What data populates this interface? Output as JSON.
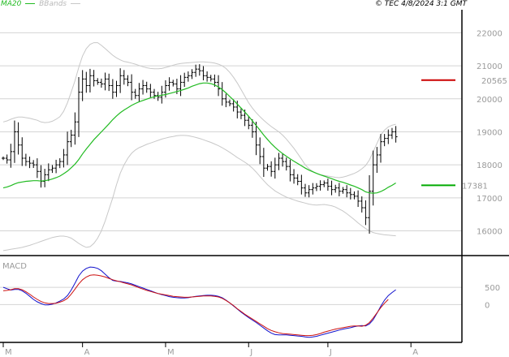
{
  "header": {
    "legend_ma": "MA20",
    "legend_bb": "BBands",
    "timestamp": "© TEC 4/8/2024 3:1 GMT"
  },
  "colors": {
    "ma": "#22bb22",
    "bbands": "#c8c8c8",
    "price": "#000000",
    "macd": "#1111cc",
    "signal": "#cc1111",
    "grid": "#d4d4d4",
    "resistance": "#cc0000",
    "support": "#00aa00"
  },
  "chart_data": [
    {
      "type": "line",
      "panel": "price",
      "title": "",
      "y_ticks": [
        16000,
        17000,
        18000,
        19000,
        20000,
        21000,
        22000
      ],
      "ylim": [
        15300,
        22600
      ],
      "x_labels": [
        "M",
        "A",
        "M",
        "J",
        "J",
        "A"
      ],
      "x_label_index": [
        0,
        21,
        43,
        65,
        86,
        108
      ],
      "series": [
        {
          "name": "price",
          "type": "ohlc",
          "values": [
            18200,
            18150,
            18400,
            19000,
            18600,
            18200,
            18100,
            18050,
            18000,
            17800,
            17500,
            17700,
            17850,
            17900,
            18000,
            18100,
            18300,
            18700,
            18900,
            19300,
            20200,
            20600,
            20400,
            20700,
            20550,
            20500,
            20450,
            20600,
            20400,
            20200,
            20400,
            20700,
            20600,
            20500,
            20200,
            20100,
            20300,
            20400,
            20300,
            20200,
            20100,
            20050,
            20200,
            20400,
            20500,
            20450,
            20300,
            20500,
            20650,
            20700,
            20800,
            20900,
            20850,
            20700,
            20650,
            20600,
            20500,
            20300,
            20000,
            19900,
            19850,
            19750,
            19600,
            19500,
            19350,
            19200,
            19000,
            18600,
            18250,
            17900,
            17950,
            17800,
            18000,
            18200,
            18100,
            17950,
            17700,
            17600,
            17500,
            17300,
            17150,
            17250,
            17300,
            17350,
            17400,
            17450,
            17350,
            17250,
            17300,
            17200,
            17250,
            17150,
            17100,
            17050,
            16900,
            16700,
            16400,
            17200,
            18000,
            18300,
            18700,
            18800,
            18900,
            19000,
            18850
          ]
        },
        {
          "name": "MA20",
          "values": [
            17300,
            17330,
            17370,
            17420,
            17460,
            17480,
            17500,
            17510,
            17520,
            17520,
            17510,
            17520,
            17540,
            17570,
            17610,
            17660,
            17730,
            17810,
            17910,
            18020,
            18160,
            18330,
            18480,
            18620,
            18760,
            18880,
            19000,
            19120,
            19240,
            19370,
            19480,
            19580,
            19660,
            19730,
            19800,
            19860,
            19910,
            19950,
            19990,
            20030,
            20060,
            20090,
            20110,
            20130,
            20160,
            20190,
            20220,
            20250,
            20290,
            20330,
            20380,
            20420,
            20460,
            20480,
            20480,
            20460,
            20420,
            20360,
            20280,
            20180,
            20070,
            19960,
            19840,
            19720,
            19600,
            19470,
            19330,
            19190,
            19050,
            18900,
            18770,
            18640,
            18530,
            18430,
            18340,
            18260,
            18180,
            18110,
            18040,
            17970,
            17900,
            17840,
            17790,
            17740,
            17700,
            17660,
            17620,
            17580,
            17540,
            17500,
            17470,
            17430,
            17390,
            17350,
            17300,
            17250,
            17180,
            17150,
            17140,
            17150,
            17190,
            17250,
            17320,
            17380,
            17450
          ]
        },
        {
          "name": "BB upper",
          "values": [
            19300,
            19330,
            19380,
            19420,
            19450,
            19450,
            19430,
            19410,
            19380,
            19350,
            19300,
            19280,
            19290,
            19320,
            19380,
            19460,
            19620,
            19880,
            20200,
            20550,
            20950,
            21300,
            21520,
            21650,
            21700,
            21700,
            21620,
            21520,
            21420,
            21320,
            21240,
            21180,
            21130,
            21110,
            21080,
            21050,
            21010,
            20970,
            20940,
            20920,
            20910,
            20910,
            20920,
            20950,
            20980,
            21020,
            21050,
            21070,
            21080,
            21090,
            21100,
            21110,
            21120,
            21120,
            21110,
            21100,
            21080,
            21050,
            21000,
            20920,
            20800,
            20650,
            20480,
            20280,
            20080,
            19880,
            19720,
            19580,
            19460,
            19350,
            19250,
            19160,
            19080,
            19000,
            18900,
            18780,
            18640,
            18500,
            18340,
            18170,
            18000,
            17880,
            17800,
            17740,
            17700,
            17680,
            17660,
            17640,
            17620,
            17610,
            17630,
            17660,
            17700,
            17740,
            17800,
            17880,
            17980,
            18150,
            18400,
            18650,
            18900,
            19050,
            19150,
            19200,
            19230
          ]
        },
        {
          "name": "BB lower",
          "values": [
            15400,
            15420,
            15440,
            15460,
            15480,
            15500,
            15530,
            15560,
            15600,
            15640,
            15680,
            15720,
            15760,
            15800,
            15820,
            15840,
            15840,
            15820,
            15780,
            15700,
            15620,
            15550,
            15500,
            15520,
            15620,
            15780,
            16000,
            16300,
            16650,
            17000,
            17400,
            17750,
            18000,
            18200,
            18350,
            18450,
            18520,
            18570,
            18620,
            18660,
            18700,
            18740,
            18780,
            18810,
            18840,
            18860,
            18880,
            18890,
            18890,
            18880,
            18860,
            18830,
            18800,
            18760,
            18720,
            18680,
            18630,
            18580,
            18520,
            18450,
            18380,
            18300,
            18220,
            18150,
            18080,
            18000,
            17900,
            17780,
            17650,
            17520,
            17400,
            17300,
            17210,
            17140,
            17080,
            17020,
            16980,
            16940,
            16900,
            16870,
            16840,
            16810,
            16790,
            16780,
            16790,
            16800,
            16780,
            16760,
            16720,
            16660,
            16600,
            16520,
            16430,
            16340,
            16240,
            16150,
            16070,
            16000,
            15950,
            15920,
            15900,
            15880,
            15870,
            15860,
            15850
          ]
        }
      ],
      "annotations": [
        {
          "label": "20565",
          "value": 20565
        },
        {
          "label": "17381",
          "value": 17381
        }
      ]
    },
    {
      "type": "line",
      "panel": "indicator",
      "title": "MACD",
      "y_ticks": [
        0,
        500
      ],
      "ylim": [
        -1050,
        1350
      ],
      "series": [
        {
          "name": "MACD",
          "values": [
            500,
            460,
            420,
            440,
            440,
            400,
            330,
            240,
            150,
            80,
            30,
            -10,
            -10,
            10,
            50,
            100,
            160,
            260,
            420,
            620,
            830,
            970,
            1050,
            1090,
            1080,
            1050,
            980,
            880,
            780,
            700,
            680,
            670,
            650,
            630,
            600,
            560,
            520,
            480,
            440,
            400,
            360,
            320,
            290,
            260,
            230,
            210,
            200,
            190,
            190,
            200,
            220,
            240,
            250,
            260,
            270,
            270,
            260,
            240,
            200,
            130,
            50,
            -40,
            -130,
            -220,
            -300,
            -380,
            -450,
            -520,
            -600,
            -680,
            -760,
            -830,
            -870,
            -880,
            -880,
            -880,
            -890,
            -900,
            -910,
            -920,
            -940,
            -950,
            -940,
            -920,
            -890,
            -860,
            -830,
            -800,
            -770,
            -740,
            -710,
            -690,
            -670,
            -640,
            -620,
            -610,
            -620,
            -560,
            -440,
            -250,
            -50,
            130,
            260,
            350,
            430
          ]
        },
        {
          "name": "Signal",
          "values": [
            400,
            410,
            430,
            460,
            460,
            430,
            370,
            300,
            220,
            150,
            90,
            50,
            30,
            30,
            40,
            70,
            110,
            180,
            300,
            450,
            600,
            720,
            800,
            850,
            860,
            850,
            830,
            800,
            760,
            720,
            690,
            660,
            630,
            600,
            570,
            530,
            490,
            450,
            410,
            380,
            350,
            320,
            300,
            280,
            260,
            240,
            230,
            220,
            210,
            210,
            220,
            230,
            240,
            250,
            250,
            250,
            240,
            220,
            180,
            120,
            50,
            -30,
            -120,
            -200,
            -280,
            -350,
            -420,
            -490,
            -560,
            -630,
            -700,
            -750,
            -790,
            -820,
            -840,
            -850,
            -860,
            -870,
            -880,
            -890,
            -900,
            -900,
            -890,
            -870,
            -840,
            -800,
            -770,
            -740,
            -710,
            -690,
            -670,
            -650,
            -630,
            -620,
            -620,
            -630,
            -600,
            -520,
            -390,
            -240,
            -90,
            40,
            150
          ]
        }
      ]
    }
  ]
}
